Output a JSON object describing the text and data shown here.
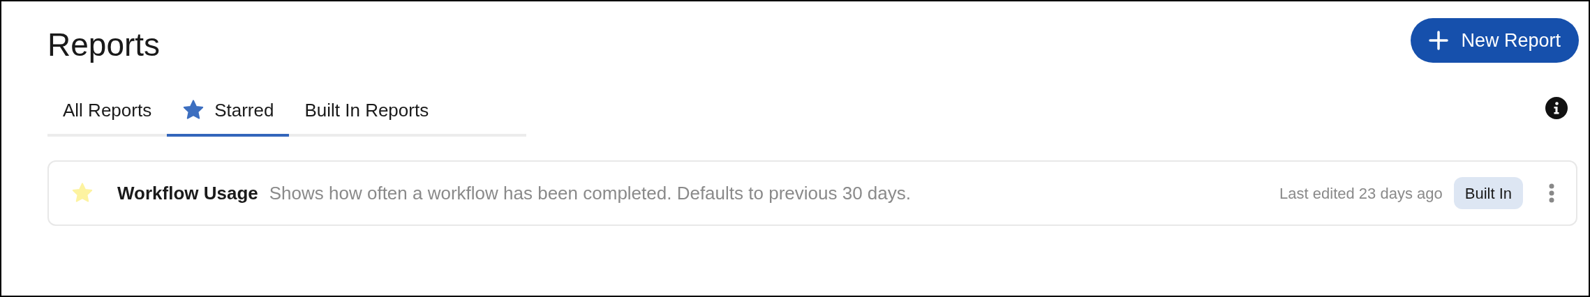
{
  "page": {
    "title": "Reports"
  },
  "new_button": {
    "label": "New Report"
  },
  "tabs": [
    {
      "label": "All Reports",
      "kind": "plain",
      "selected": false
    },
    {
      "label": "Starred",
      "kind": "starred",
      "selected": true
    },
    {
      "label": "Built In Reports",
      "kind": "plain",
      "selected": false
    }
  ],
  "reports": [
    {
      "starred": true,
      "title": "Workflow Usage",
      "description": "Shows how often a workflow has been completed. Defaults to previous 30 days.",
      "edited": "Last edited 23 days ago",
      "badge": "Built In"
    }
  ]
}
